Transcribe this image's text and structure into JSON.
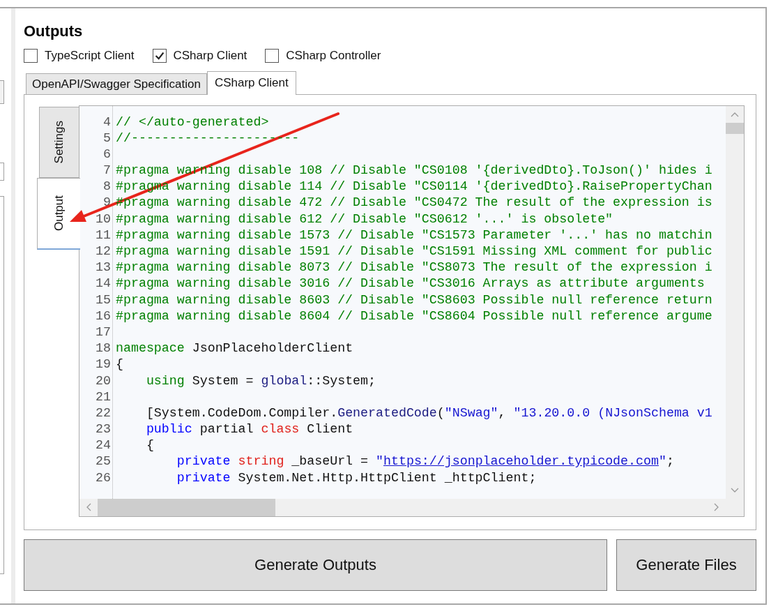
{
  "section_title": "Outputs",
  "output_options": [
    {
      "label": "TypeScript Client",
      "checked": false
    },
    {
      "label": "CSharp Client",
      "checked": true
    },
    {
      "label": "CSharp Controller",
      "checked": false
    }
  ],
  "tabs": [
    {
      "label": "OpenAPI/Swagger Specification",
      "selected": false
    },
    {
      "label": "CSharp Client",
      "selected": true
    }
  ],
  "side_tabs": [
    {
      "label": "Settings",
      "selected": false
    },
    {
      "label": "Output",
      "selected": true
    }
  ],
  "code_editor": {
    "lines": [
      {
        "number": "4",
        "tokens": [
          {
            "kind": "comment",
            "text": "// </auto-generated>"
          }
        ]
      },
      {
        "number": "5",
        "tokens": [
          {
            "kind": "comment",
            "text": "//----------------------"
          }
        ]
      },
      {
        "number": "6"
      },
      {
        "number": "7",
        "tokens": [
          {
            "kind": "directive",
            "text": "#pragma warning disable 108 // Disable \"CS0108 '{derivedDto}.ToJson()' hides i"
          }
        ]
      },
      {
        "number": "8",
        "tokens": [
          {
            "kind": "directive",
            "text": "#pragma warning disable 114 // Disable \"CS0114 '{derivedDto}.RaisePropertyChan"
          }
        ]
      },
      {
        "number": "9",
        "tokens": [
          {
            "kind": "directive",
            "text": "#pragma warning disable 472 // Disable \"CS0472 The result of the expression is"
          }
        ]
      },
      {
        "number": "10",
        "tokens": [
          {
            "kind": "directive",
            "text": "#pragma warning disable 612 // Disable \"CS0612 '...' is obsolete\""
          }
        ]
      },
      {
        "number": "11",
        "tokens": [
          {
            "kind": "directive",
            "text": "#pragma warning disable 1573 // Disable \"CS1573 Parameter '...' has no matchin"
          }
        ]
      },
      {
        "number": "12",
        "tokens": [
          {
            "kind": "directive",
            "text": "#pragma warning disable 1591 // Disable \"CS1591 Missing XML comment for public"
          }
        ]
      },
      {
        "number": "13",
        "tokens": [
          {
            "kind": "directive",
            "text": "#pragma warning disable 8073 // Disable \"CS8073 The result of the expression i"
          }
        ]
      },
      {
        "number": "14",
        "tokens": [
          {
            "kind": "directive",
            "text": "#pragma warning disable 3016 // Disable \"CS3016 Arrays as attribute arguments"
          }
        ]
      },
      {
        "number": "15",
        "tokens": [
          {
            "kind": "directive",
            "text": "#pragma warning disable 8603 // Disable \"CS8603 Possible null reference return"
          }
        ]
      },
      {
        "number": "16",
        "tokens": [
          {
            "kind": "directive",
            "text": "#pragma warning disable 8604 // Disable \"CS8604 Possible null reference argume"
          }
        ]
      },
      {
        "number": "17"
      },
      {
        "number": "18",
        "tokens": [
          {
            "kind": "declaration",
            "text": "namespace"
          },
          {
            "kind": "plain",
            "text": " JsonPlaceholderClient"
          }
        ]
      },
      {
        "number": "19",
        "tokens": [
          {
            "kind": "plain",
            "text": "{"
          }
        ]
      },
      {
        "number": "20",
        "tokens": [
          {
            "kind": "declaration",
            "text": "    using"
          },
          {
            "kind": "plain",
            "text": " System = "
          },
          {
            "kind": "identifier",
            "text": "global"
          },
          {
            "kind": "plain",
            "text": "::System;"
          }
        ]
      },
      {
        "number": "21"
      },
      {
        "number": "22",
        "tokens": [
          {
            "kind": "plain",
            "text": "    [System.CodeDom.Compiler."
          },
          {
            "kind": "identifier",
            "text": "GeneratedCode"
          },
          {
            "kind": "plain",
            "text": "("
          },
          {
            "kind": "string",
            "text": "\"NSwag\""
          },
          {
            "kind": "plain",
            "text": ", "
          },
          {
            "kind": "string",
            "text": "\"13.20.0.0 (NJsonSchema v1"
          }
        ]
      },
      {
        "number": "23",
        "tokens": [
          {
            "kind": "keyword",
            "text": "    public"
          },
          {
            "kind": "plain",
            "text": " partial "
          },
          {
            "kind": "type",
            "text": "class"
          },
          {
            "kind": "plain",
            "text": " Client"
          }
        ]
      },
      {
        "number": "24",
        "tokens": [
          {
            "kind": "plain",
            "text": "    {"
          }
        ]
      },
      {
        "number": "25",
        "tokens": [
          {
            "kind": "keyword",
            "text": "        private"
          },
          {
            "kind": "type",
            "text": " string"
          },
          {
            "kind": "plain",
            "text": " _baseUrl = "
          },
          {
            "kind": "string",
            "text": "\""
          },
          {
            "kind": "link",
            "text": "https://jsonplaceholder.typicode.com"
          },
          {
            "kind": "string",
            "text": "\""
          },
          {
            "kind": "plain",
            "text": ";"
          }
        ]
      },
      {
        "number": "26",
        "tokens": [
          {
            "kind": "keyword",
            "text": "        private"
          },
          {
            "kind": "plain",
            "text": " System.Net.Http.HttpClient _httpClient;"
          }
        ]
      }
    ]
  },
  "buttons": [
    "Generate Outputs",
    "Generate Files"
  ]
}
